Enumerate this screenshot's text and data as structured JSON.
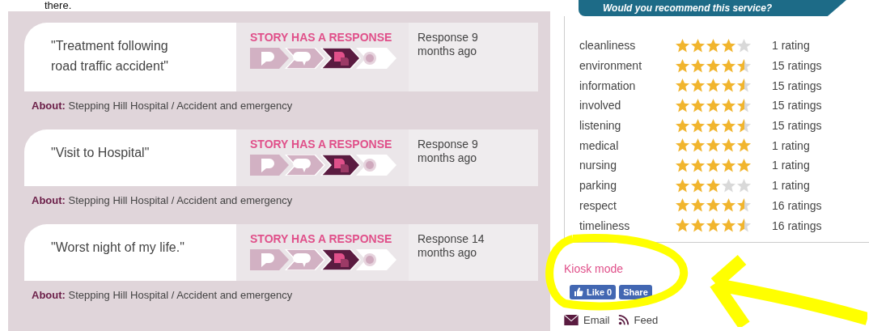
{
  "intro_text": "there.",
  "stories": [
    {
      "title": "\"Treatment following road traffic accident\"",
      "status": "STORY HAS A RESPONSE",
      "steps": [
        {
          "kind": "done"
        },
        {
          "kind": "done"
        },
        {
          "kind": "current"
        },
        {
          "kind": "pending"
        }
      ],
      "response": "Response 9 months ago",
      "about_label": "About:",
      "about": "Stepping Hill Hospital / Accident and emergency"
    },
    {
      "title": "\"Visit to Hospital\"",
      "status": "STORY HAS A RESPONSE",
      "steps": [
        {
          "kind": "done"
        },
        {
          "kind": "done"
        },
        {
          "kind": "current"
        },
        {
          "kind": "pending"
        }
      ],
      "response": "Response 9 months ago",
      "about_label": "About:",
      "about": "Stepping Hill Hospital / Accident and emergency"
    },
    {
      "title": "\"Worst night of my life.\"",
      "status": "STORY HAS A RESPONSE",
      "steps": [
        {
          "kind": "done"
        },
        {
          "kind": "done"
        },
        {
          "kind": "current"
        },
        {
          "kind": "pending"
        }
      ],
      "response": "Response 14 months ago",
      "about_label": "About:",
      "about": "Stepping Hill Hospital / Accident and emergency"
    }
  ],
  "recommend_banner": "Would you recommend this service?",
  "ratings": [
    {
      "label": "cleanliness",
      "stars": 4,
      "count": "1 rating"
    },
    {
      "label": "environment",
      "stars": 4.5,
      "count": "15 ratings"
    },
    {
      "label": "information",
      "stars": 4.5,
      "count": "15 ratings"
    },
    {
      "label": "involved",
      "stars": 4.5,
      "count": "15 ratings"
    },
    {
      "label": "listening",
      "stars": 4.5,
      "count": "15 ratings"
    },
    {
      "label": "medical",
      "stars": 5,
      "count": "1 rating"
    },
    {
      "label": "nursing",
      "stars": 5,
      "count": "1 rating"
    },
    {
      "label": "parking",
      "stars": 3,
      "count": "1 rating"
    },
    {
      "label": "respect",
      "stars": 4.5,
      "count": "16 ratings"
    },
    {
      "label": "timeliness",
      "stars": 4.5,
      "count": "16 ratings"
    }
  ],
  "kiosk_link": "Kiosk mode",
  "like_button": "Like 0",
  "share_button": "Share",
  "footer_links": [
    {
      "kind": "email",
      "label": "Email"
    },
    {
      "kind": "feed",
      "label": "Feed"
    }
  ]
}
